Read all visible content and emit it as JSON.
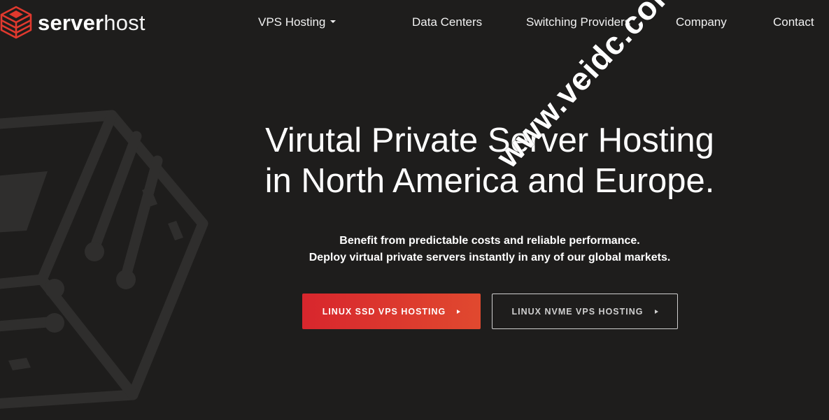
{
  "brand": {
    "name_bold": "server",
    "name_light": "host",
    "accent_color": "#e0392e",
    "logo_icon": "stacked-server-cube-icon"
  },
  "nav": {
    "items": [
      {
        "label": "VPS Hosting",
        "has_dropdown": true
      },
      {
        "label": "Data Centers"
      },
      {
        "label": "Switching Providers"
      },
      {
        "label": "Company"
      },
      {
        "label": "Contact"
      }
    ]
  },
  "hero": {
    "title_line1": "Virutal Private Server Hosting",
    "title_line2": "in North America and Europe.",
    "subtitle_line1": "Benefit from predictable costs and reliable performance.",
    "subtitle_line2": "Deploy virtual private servers instantly in any of our global markets.",
    "primary_button": "LINUX SSD VPS HOSTING",
    "secondary_button": "LINUX NVME VPS HOSTING",
    "button_arrow_icon": "triangle-right-icon"
  },
  "watermark": "www.veidc.com",
  "colors": {
    "background": "#1e1d1c",
    "primary_button_start": "#d8262d",
    "primary_button_end": "#e0492f",
    "secondary_button_border": "#cfcfcf"
  }
}
